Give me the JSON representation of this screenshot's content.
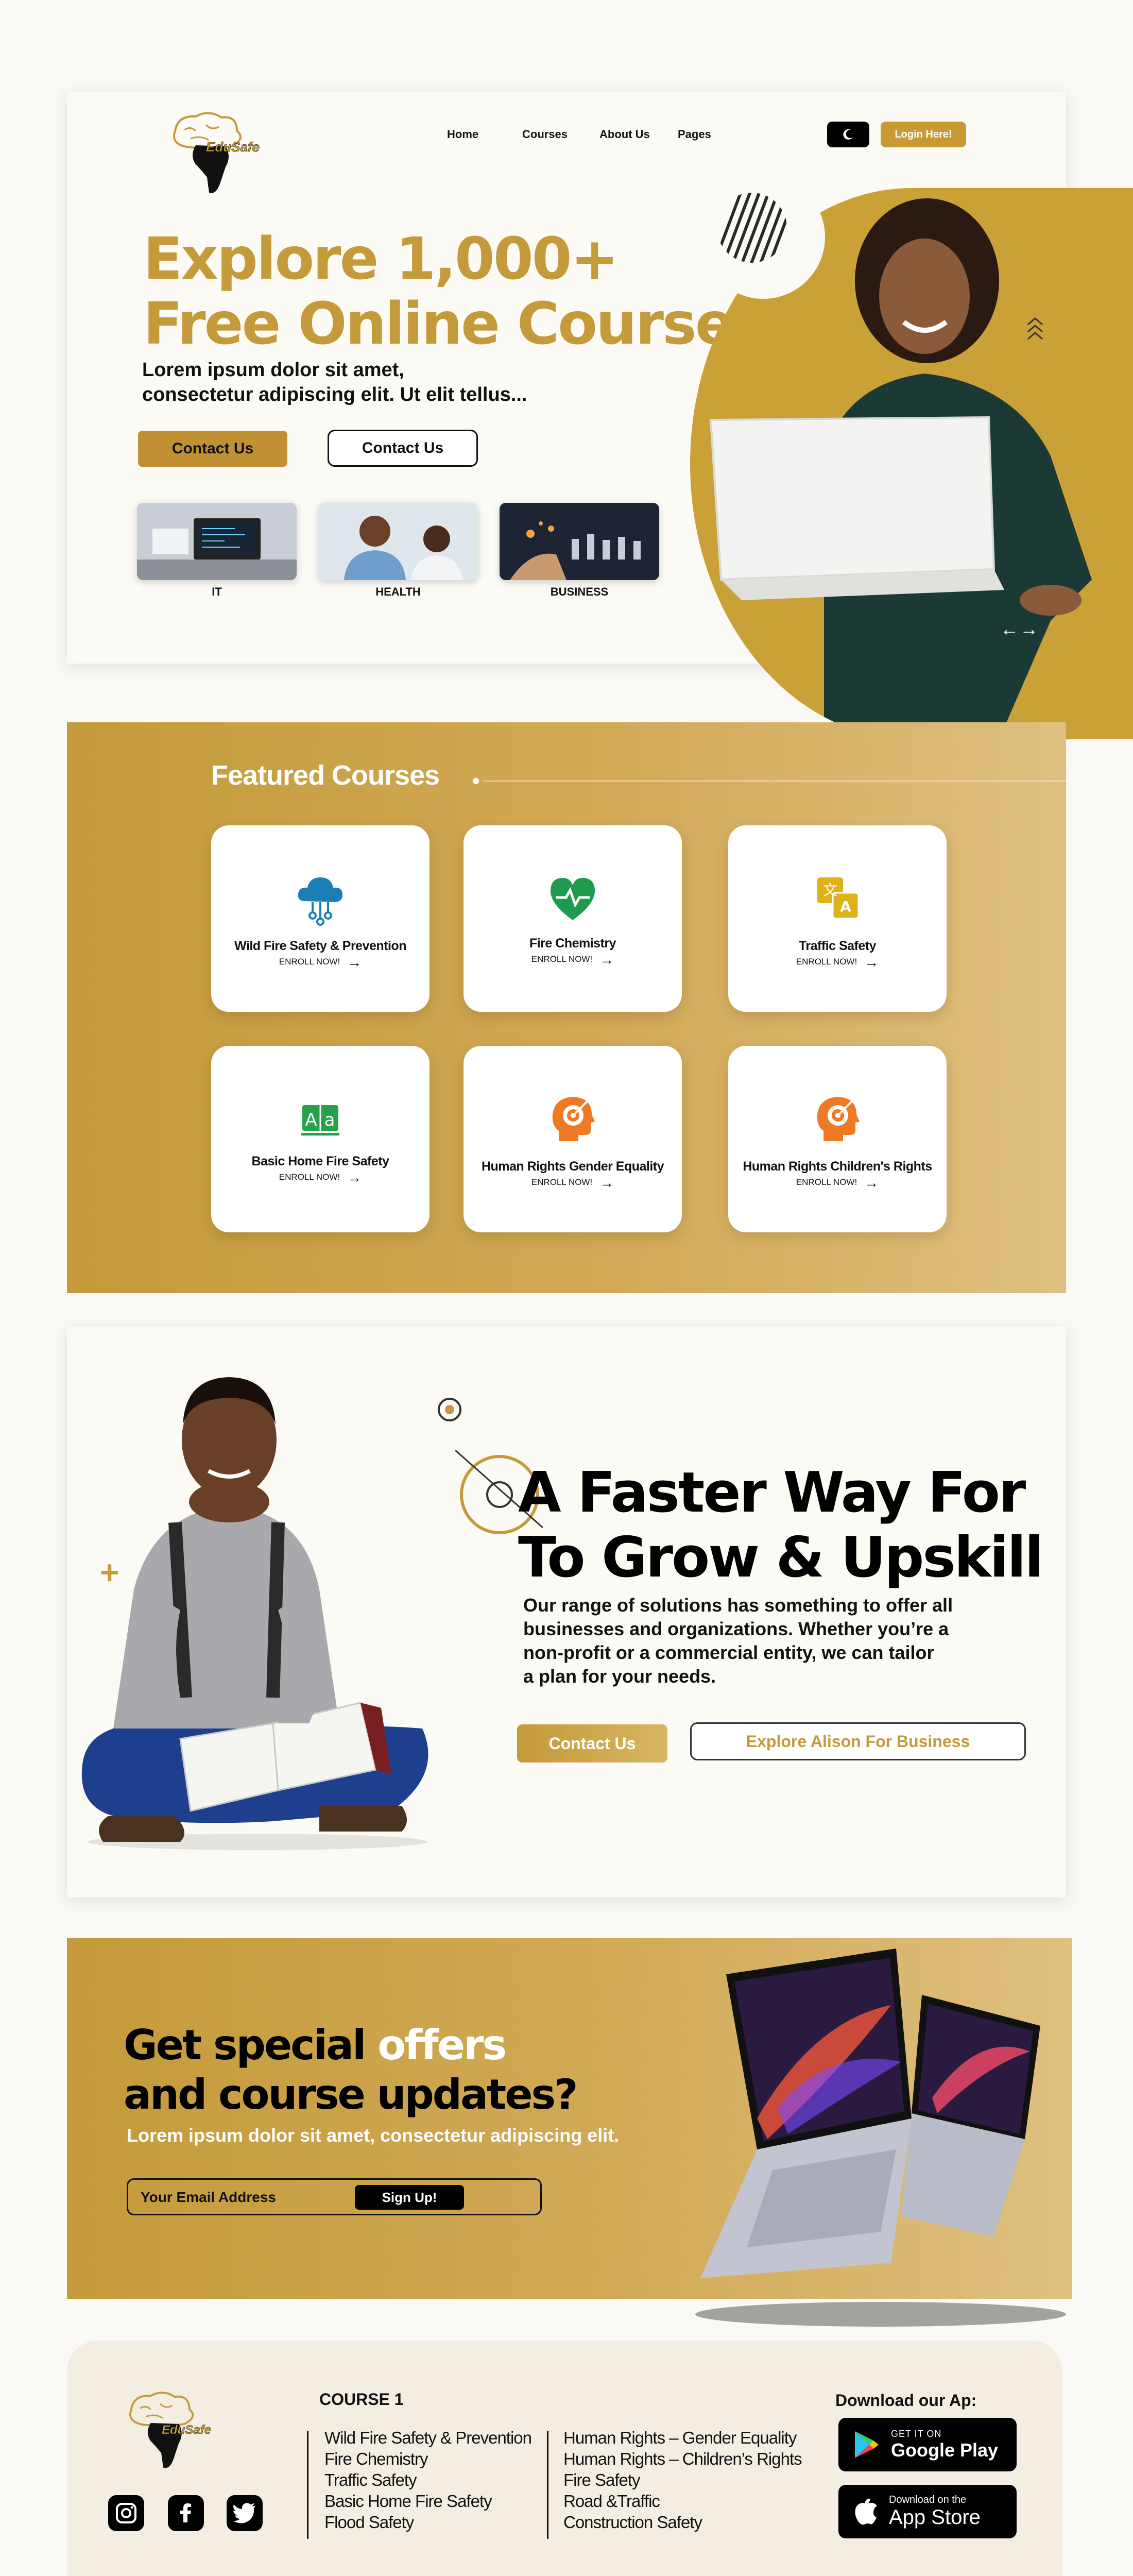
{
  "brand": {
    "logo_text": "EduSafe"
  },
  "nav": {
    "links": [
      "Home",
      "Courses",
      "About Us",
      "Pages"
    ],
    "login_label": "Login Here!"
  },
  "hero": {
    "title_line1": "Explore 1,000+",
    "title_line2": "Free Online Courses",
    "subtitle_line1": "Lorem ipsum dolor sit amet,",
    "subtitle_line2": "consectetur adipiscing elit. Ut elit tellus...",
    "primary_cta": "Contact Us",
    "secondary_cta": "Contact Us",
    "categories": [
      {
        "label": "IT"
      },
      {
        "label": "HEALTH"
      },
      {
        "label": "BUSINESS"
      }
    ],
    "arrows": "←→"
  },
  "featured": {
    "title": "Featured Courses",
    "enroll_label": "ENROLL NOW!",
    "courses": [
      {
        "name": "Wild Fire Safety & Prevention",
        "icon": "cloud-network-icon",
        "color": "#1a7fb5"
      },
      {
        "name": "Fire Chemistry",
        "icon": "heart-pulse-icon",
        "color": "#1e9b4e"
      },
      {
        "name": "Traffic Safety",
        "icon": "translate-icon",
        "color": "#e0b21a"
      },
      {
        "name": "Basic Home Fire Safety",
        "icon": "text-aa-icon",
        "color": "#27a24b"
      },
      {
        "name": "Human Rights Gender Equality",
        "icon": "head-target-icon",
        "color": "#f07a24"
      },
      {
        "name": "Human Rights Children's Rights",
        "icon": "head-target-icon",
        "color": "#f07a24"
      }
    ]
  },
  "upskill": {
    "title_line1": "A Faster Way For",
    "title_line2": "To Grow & Upskill",
    "body": [
      "Our range of solutions has something to offer all",
      "businesses and organizations. Whether you’re a",
      "non-profit or a commercial entity, we can tailor",
      "a plan for your needs."
    ],
    "primary_cta": "Contact Us",
    "secondary_cta": "Explore Alison For Business"
  },
  "newsletter": {
    "title_a": "Get special ",
    "title_b": "offers",
    "title_line2": "and course updates?",
    "subtitle": "Lorem ipsum dolor sit amet, consectetur adipiscing elit.",
    "email_placeholder": "Your Email Address",
    "submit_label": "Sign Up!"
  },
  "footer": {
    "column_title": "COURSE 1",
    "col1": [
      "Wild Fire Safety & Prevention",
      "Fire Chemistry",
      "Traffic Safety",
      "Basic Home Fire Safety",
      "Flood Safety"
    ],
    "col2": [
      "Human Rights – Gender Equality",
      "Human Rights – Children’s Rights",
      "Fire Safety",
      "Road &Traffic",
      "Construction Safety"
    ],
    "download_title": "Download  our Ap:",
    "google_small": "GET IT ON",
    "google_big": "Google Play",
    "apple_small": "Download on the",
    "apple_big": "App Store"
  },
  "colors": {
    "gold": "#c49a3a",
    "gold_light": "#dfc080",
    "cream": "#fbfaf5"
  }
}
